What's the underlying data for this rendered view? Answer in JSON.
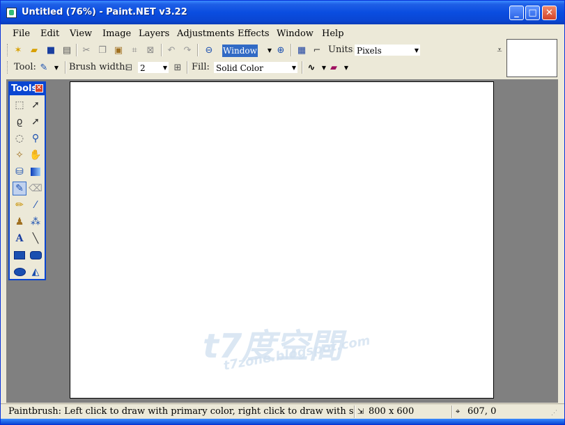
{
  "window": {
    "title": "Untitled (76%) - Paint.NET v3.22"
  },
  "caption_buttons": {
    "minimize": "_",
    "maximize": "□",
    "close": "✕"
  },
  "menu": [
    "File",
    "Edit",
    "View",
    "Image",
    "Layers",
    "Adjustments",
    "Effects",
    "Window",
    "Help"
  ],
  "toolbar1": {
    "zoom_value": "Window",
    "units_label": "Units:",
    "units_value": "Pixels"
  },
  "toolbar2": {
    "tool_label": "Tool:",
    "brush_width_label": "Brush width:",
    "brush_width_value": "2",
    "fill_label": "Fill:",
    "fill_value": "Solid Color"
  },
  "tools_panel": {
    "title": "Tools",
    "items": [
      "rectangle-select-icon",
      "move-selection-icon",
      "lasso-select-icon",
      "move-selected-icon",
      "ellipse-select-icon",
      "zoom-icon",
      "magic-wand-icon",
      "pan-icon",
      "paint-bucket-icon",
      "gradient-icon",
      "paintbrush-icon",
      "eraser-icon",
      "pencil-icon",
      "color-picker-icon",
      "clone-stamp-icon",
      "recolor-icon",
      "text-icon",
      "line-curve-icon",
      "rectangle-icon",
      "rounded-rectangle-icon",
      "ellipse-icon",
      "freeform-shape-icon"
    ],
    "active": "paintbrush-icon"
  },
  "canvas": {
    "watermark_main": "t7度空間",
    "watermark_sub": "t7zone.blogspot.com"
  },
  "status": {
    "hint": "Paintbrush: Left click to draw with primary color, right click to draw with secondary colo",
    "image_size": "800 x 600",
    "cursor_position": "607, 0"
  },
  "colors": {
    "titlebar": "#0a46d2",
    "workspace": "#808080",
    "chrome": "#ece9d8",
    "selection": "#316ac5"
  }
}
